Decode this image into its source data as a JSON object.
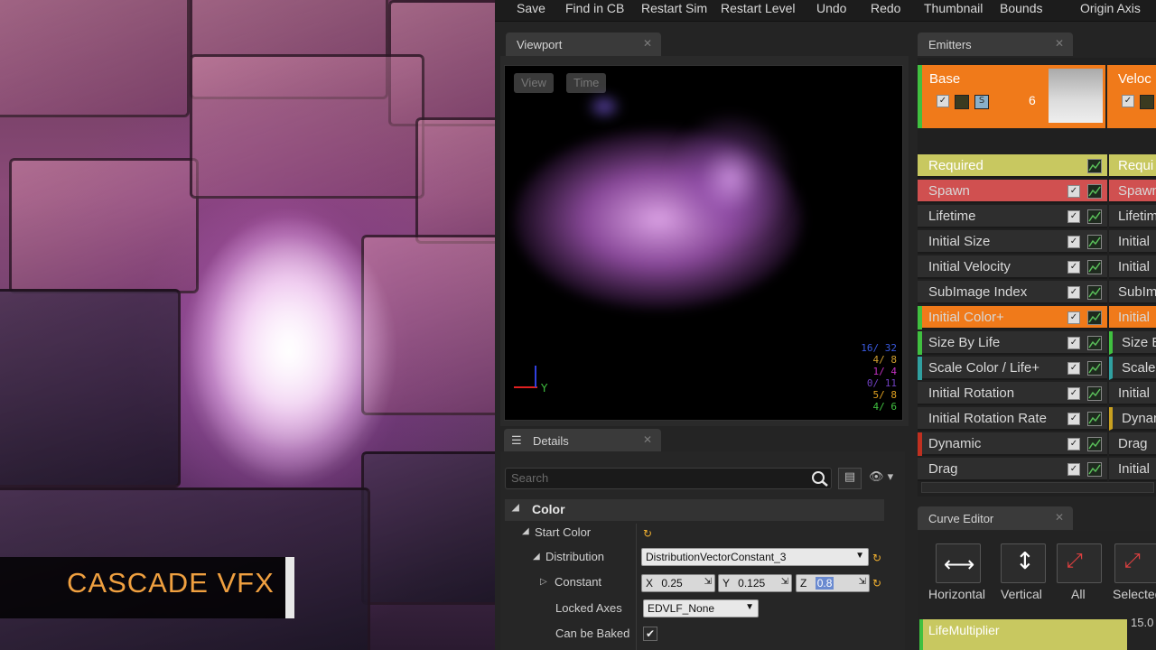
{
  "toolbar": {
    "buttons": [
      "Save",
      "Find in CB",
      "Restart Sim",
      "Restart Level",
      "Undo",
      "Redo",
      "Thumbnail",
      "Bounds",
      "Origin Axis"
    ]
  },
  "brand": {
    "title": "CASCADE VFX"
  },
  "viewport": {
    "tab": "Viewport",
    "view_btn": "View",
    "time_btn": "Time",
    "axis_label": "Y",
    "stats": [
      {
        "text": "16/ 32",
        "color": "#3a5ae0"
      },
      {
        "text": "4/ 8",
        "color": "#d0a030"
      },
      {
        "text": "1/ 4",
        "color": "#c030c0"
      },
      {
        "text": "0/ 11",
        "color": "#7040c0"
      },
      {
        "text": "5/ 8",
        "color": "#e0a020"
      },
      {
        "text": "4/ 6",
        "color": "#40c040"
      }
    ]
  },
  "details": {
    "tab": "Details",
    "search_placeholder": "Search",
    "category": "Color",
    "start_color": "Start Color",
    "distribution_label": "Distribution",
    "distribution_value": "DistributionVectorConstant_3",
    "constant_label": "Constant",
    "x_label": "X",
    "x_value": "0.25",
    "y_label": "Y",
    "y_value": "0.125",
    "z_label": "Z",
    "z_value": "0.8",
    "locked_axes_label": "Locked Axes",
    "locked_axes_value": "EDVLF_None",
    "can_be_baked_label": "Can be Baked",
    "can_be_baked": true
  },
  "emitters": {
    "tab": "Emitters",
    "base_name": "Base",
    "base_count": "6",
    "second_name": "Veloc",
    "modules": [
      {
        "label": "Required",
        "color": "#c8c860",
        "strip": ""
      },
      {
        "label": "Spawn",
        "color": "#d05050",
        "strip": ""
      },
      {
        "label": "Lifetime",
        "color": "",
        "strip": ""
      },
      {
        "label": "Initial Size",
        "color": "",
        "strip": ""
      },
      {
        "label": "Initial Velocity",
        "color": "",
        "strip": ""
      },
      {
        "label": "SubImage Index",
        "color": "",
        "strip": ""
      },
      {
        "label": "Initial Color+",
        "color": "#f07a1a",
        "strip": "#40c040"
      },
      {
        "label": "Size By Life",
        "color": "",
        "strip": "#40c040"
      },
      {
        "label": "Scale Color / Life+",
        "color": "",
        "strip": "#30a0a0"
      },
      {
        "label": "Initial Rotation",
        "color": "",
        "strip": ""
      },
      {
        "label": "Initial Rotation Rate",
        "color": "",
        "strip": ""
      },
      {
        "label": "Dynamic",
        "color": "",
        "strip": "#c03020"
      },
      {
        "label": "Drag",
        "color": "",
        "strip": ""
      }
    ],
    "modules2": [
      "Requi",
      "Spawn",
      "Lifetim",
      "Initial",
      "Initial",
      "SubIm",
      "Initial",
      "Size E",
      "Scale",
      "Initial",
      "Dynan",
      "Drag",
      "Initial"
    ]
  },
  "curve_editor": {
    "tab": "Curve Editor",
    "buttons": [
      "Horizontal",
      "Vertical",
      "All",
      "Selected"
    ],
    "track_label": "LifeMultiplier",
    "value_label": "15.0"
  }
}
